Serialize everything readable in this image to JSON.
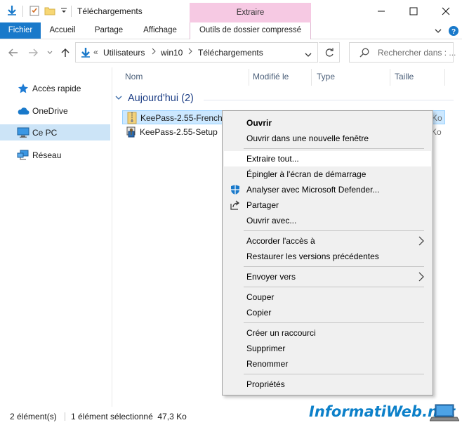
{
  "window": {
    "title": "Téléchargements",
    "contextual_group": "Extraire"
  },
  "ribbon": {
    "tabs": [
      "Fichier",
      "Accueil",
      "Partage",
      "Affichage",
      "Outils de dossier compressé"
    ]
  },
  "address": {
    "breadcrumb_prefix": "«",
    "crumbs": [
      "Utilisateurs",
      "win10",
      "Téléchargements"
    ],
    "search_placeholder": "Rechercher dans : ..."
  },
  "sidebar": {
    "items": [
      {
        "label": "Accès rapide",
        "icon": "star-icon"
      },
      {
        "label": "OneDrive",
        "icon": "cloud-icon"
      },
      {
        "label": "Ce PC",
        "icon": "computer-icon",
        "selected": true
      },
      {
        "label": "Réseau",
        "icon": "network-icon"
      }
    ]
  },
  "columns": [
    "Nom",
    "Modifié le",
    "Type",
    "Taille"
  ],
  "group": {
    "title": "Aujourd'hui (2)"
  },
  "files": [
    {
      "name": "KeePass-2.55-French",
      "size": "Ko",
      "icon": "zip-folder-icon",
      "selected": true
    },
    {
      "name": "KeePass-2.55-Setup",
      "size": "Ko",
      "icon": "installer-icon",
      "selected": false
    }
  ],
  "context_menu": {
    "items": [
      {
        "label": "Ouvrir",
        "bold": true
      },
      {
        "label": "Ouvrir dans une nouvelle fenêtre"
      },
      {
        "label": "Extraire tout...",
        "highlight": true
      },
      {
        "label": "Épingler à l'écran de démarrage"
      },
      {
        "label": "Analyser avec Microsoft Defender...",
        "icon": "defender-shield-icon"
      },
      {
        "label": "Partager",
        "icon": "share-icon"
      },
      {
        "label": "Ouvrir avec..."
      },
      {
        "label": "Accorder l'accès à",
        "submenu": true
      },
      {
        "label": "Restaurer les versions précédentes"
      },
      {
        "label": "Envoyer vers",
        "submenu": true
      },
      {
        "label": "Couper"
      },
      {
        "label": "Copier"
      },
      {
        "label": "Créer un raccourci"
      },
      {
        "label": "Supprimer"
      },
      {
        "label": "Renommer"
      },
      {
        "label": "Propriétés"
      }
    ]
  },
  "status": {
    "count": "2 élément(s)",
    "selection": "1 élément sélectionné  47,3 Ko"
  },
  "watermark": {
    "text": "InformatiWeb.net"
  },
  "colors": {
    "accent": "#1979ca",
    "selection": "#cce8ff",
    "nav_selected": "#cce4f7",
    "contextual_tab": "#f6c9e3",
    "menu_background": "#f0f0f0"
  }
}
